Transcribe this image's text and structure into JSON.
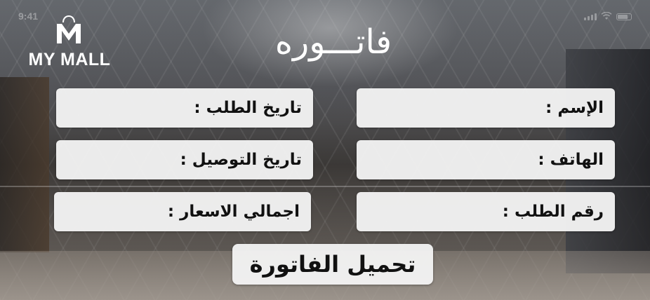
{
  "status_bar": {
    "time": "9:41"
  },
  "logo": {
    "letter": "M",
    "text": "MY MALL"
  },
  "title": "فاتـــوره",
  "fields": {
    "name_label": "الإسم :",
    "order_date_label": "تاريخ الطلب :",
    "phone_label": "الهاتف :",
    "delivery_date_label": "تاريخ التوصيل :",
    "order_number_label": "رقم الطلب :",
    "total_prices_label": "اجمالي الاسعار :"
  },
  "download_button": {
    "label": "تحميل الفاتورة"
  },
  "colors": {
    "field_background": "#f2f2f2",
    "text_dark": "#111111",
    "text_light": "#ffffff"
  }
}
